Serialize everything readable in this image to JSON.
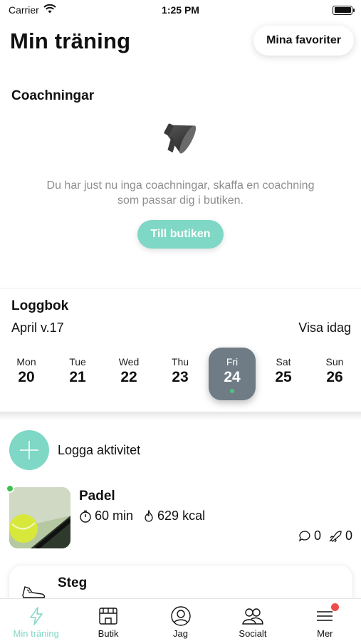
{
  "status_bar": {
    "carrier": "Carrier",
    "time": "1:25 PM"
  },
  "header": {
    "title": "Min träning",
    "favorites_label": "Mina favoriter"
  },
  "coaching": {
    "title": "Coachningar",
    "empty_line1": "Du har just nu inga coachningar, skaffa en coachning",
    "empty_line2": "som passar dig i butiken.",
    "shop_button": "Till butiken"
  },
  "logbook": {
    "title": "Loggbok",
    "week": "April v.17",
    "today_link": "Visa idag",
    "days": [
      {
        "name": "Mon",
        "num": "20"
      },
      {
        "name": "Tue",
        "num": "21"
      },
      {
        "name": "Wed",
        "num": "22"
      },
      {
        "name": "Thu",
        "num": "23"
      },
      {
        "name": "Fri",
        "num": "24"
      },
      {
        "name": "Sat",
        "num": "25"
      },
      {
        "name": "Sun",
        "num": "26"
      }
    ],
    "selected_day": "Fri"
  },
  "activity": {
    "add_label": "Logga aktivitet",
    "item": {
      "name": "Padel",
      "duration": "60 min",
      "kcal": "629 kcal",
      "comments": "0",
      "likes": "0"
    },
    "steps_label": "Steg"
  },
  "tab_bar": {
    "tabs": [
      {
        "label": "Min träning",
        "icon": "lightning-icon"
      },
      {
        "label": "Butik",
        "icon": "store-icon"
      },
      {
        "label": "Jag",
        "icon": "user-icon"
      },
      {
        "label": "Socialt",
        "icon": "people-icon"
      },
      {
        "label": "Mer",
        "icon": "menu-icon"
      }
    ]
  },
  "colors": {
    "accent": "#7fd7c5",
    "selected_day": "#6f7c86",
    "badge": "#ef4b4b",
    "active_dot": "#3cc14d"
  }
}
